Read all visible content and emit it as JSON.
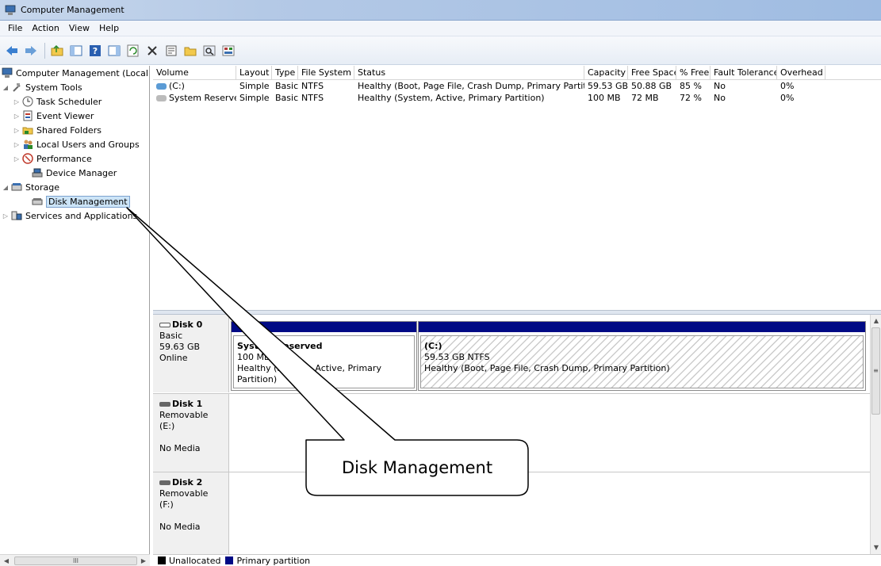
{
  "window": {
    "title": "Computer Management"
  },
  "menu": [
    "File",
    "Action",
    "View",
    "Help"
  ],
  "toolbar_icons": [
    "back-icon",
    "forward-icon",
    "up-folder-icon",
    "show-hide-tree-icon",
    "help-icon",
    "show-hide-action-pane-icon",
    "refresh-icon",
    "delete-icon",
    "properties-icon",
    "open-folder-icon",
    "search-icon",
    "more-icon"
  ],
  "tree": {
    "root": "Computer Management (Local",
    "system_tools": "System Tools",
    "task_scheduler": "Task Scheduler",
    "event_viewer": "Event Viewer",
    "shared_folders": "Shared Folders",
    "local_users": "Local Users and Groups",
    "performance": "Performance",
    "device_manager": "Device Manager",
    "storage": "Storage",
    "disk_management": "Disk Management",
    "services": "Services and Applications"
  },
  "scroll": {
    "hthumb": "III"
  },
  "volumes": {
    "columns": [
      "Volume",
      "Layout",
      "Type",
      "File System",
      "Status",
      "Capacity",
      "Free Space",
      "% Free",
      "Fault Tolerance",
      "Overhead"
    ],
    "rows": [
      [
        "(C:)",
        "Simple",
        "Basic",
        "NTFS",
        "Healthy (Boot, Page File, Crash Dump, Primary Partition)",
        "59.53 GB",
        "50.88 GB",
        "85 %",
        "No",
        "0%"
      ],
      [
        "System Reserved",
        "Simple",
        "Basic",
        "NTFS",
        "Healthy (System, Active, Primary Partition)",
        "100 MB",
        "72 MB",
        "72 %",
        "No",
        "0%"
      ]
    ]
  },
  "disks": [
    {
      "name": "Disk 0",
      "line1": "Basic",
      "line2": "59.63 GB",
      "line3": "Online"
    },
    {
      "name": "Disk 1",
      "line1": "Removable (E:)",
      "line2": "",
      "line3": "No Media"
    },
    {
      "name": "Disk 2",
      "line1": "Removable (F:)",
      "line2": "",
      "line3": "No Media"
    }
  ],
  "partitions": {
    "p1": {
      "name": "System Reserved",
      "size": "100 MB NTFS",
      "status": "Healthy (System, Active, Primary Partition)"
    },
    "p2": {
      "name": "(C:)",
      "size": "59.53 GB NTFS",
      "status": "Healthy (Boot, Page File, Crash Dump, Primary Partition)"
    }
  },
  "legend": {
    "unallocated": "Unallocated",
    "primary": "Primary partition",
    "unallocated_color": "#000000",
    "primary_color": "#000a85"
  },
  "callout": {
    "text": "Disk Management"
  }
}
